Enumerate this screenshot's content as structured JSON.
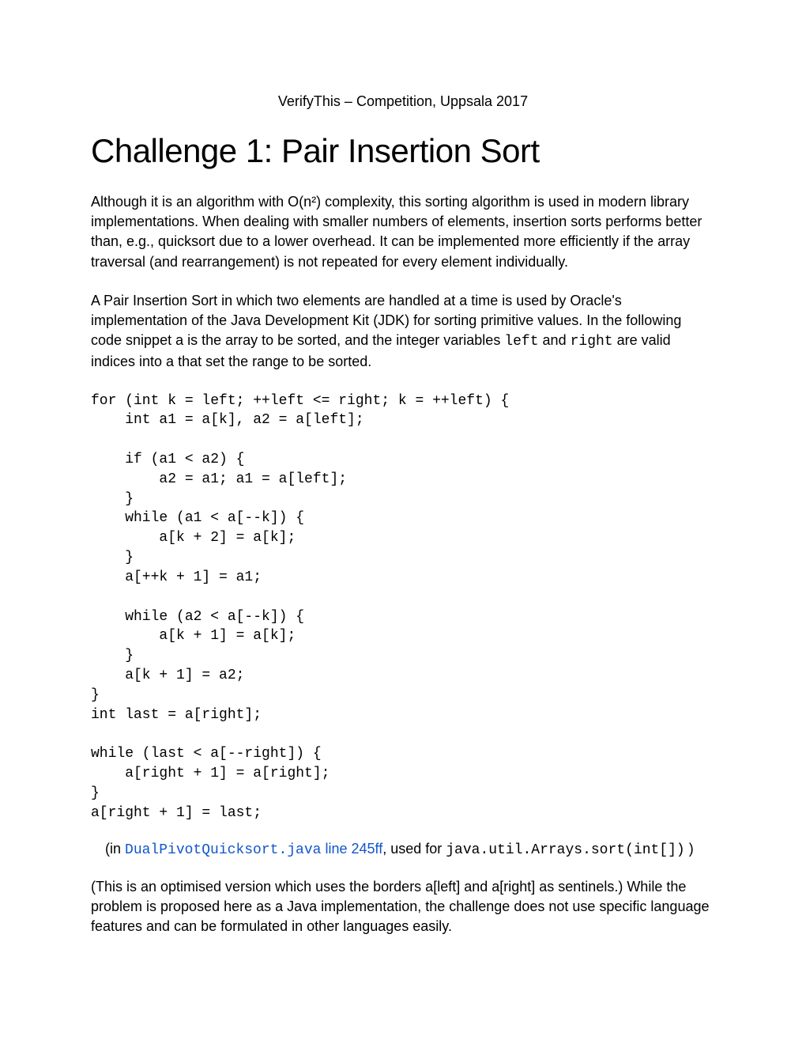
{
  "header": "VerifyThis – Competition, Uppsala 2017",
  "title": "Challenge 1: Pair Insertion Sort",
  "para1": "Although it is an algorithm with O(n²) complexity, this sorting algorithm is used in modern library implementations. When dealing with smaller numbers of elements, insertion sorts performs better than, e.g., quicksort due to a lower overhead. It can be implemented more efficiently if the array traversal (and rearrangement) is not repeated for every element individually.",
  "para2_a": "A Pair Insertion Sort in which two elements are handled at a time is used by Oracle's implementation of the Java Development Kit (JDK) for sorting primitive values. In the following code snippet a is the array to be sorted, and the integer variables ",
  "para2_code1": "left",
  "para2_b": " and ",
  "para2_code2": "right",
  "para2_c": " are valid indices into a that set the range to be sorted.",
  "code": "for (int k = left; ++left <= right; k = ++left) {\n    int a1 = a[k], a2 = a[left];\n\n    if (a1 < a2) {\n        a2 = a1; a1 = a[left];\n    }\n    while (a1 < a[--k]) {\n        a[k + 2] = a[k];\n    }\n    a[++k + 1] = a1;\n\n    while (a2 < a[--k]) {\n        a[k + 1] = a[k];\n    }\n    a[k + 1] = a2;\n}\nint last = a[right];\n\nwhile (last < a[--right]) {\n    a[right + 1] = a[right];\n}\na[right + 1] = last;",
  "citation_prefix": "(in ",
  "citation_link_mono": "DualPivotQuicksort.java",
  "citation_link_rest": " line 245ff",
  "citation_mid": ", used for ",
  "citation_code": "java.util.Arrays.sort(int[])",
  "citation_suffix": " )",
  "para3": "(This is an optimised version which uses the borders a[left] and a[right] as sentinels.) While the problem is proposed here as a Java implementation, the challenge does not use specific language features and can be formulated in other languages easily."
}
